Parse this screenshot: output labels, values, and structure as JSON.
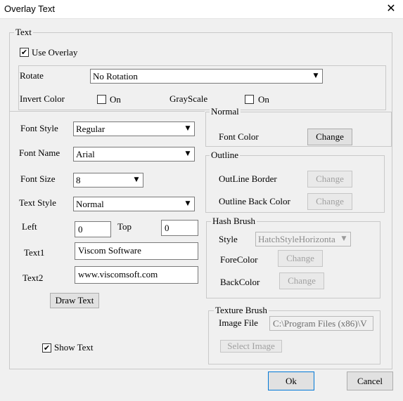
{
  "window": {
    "title": "Overlay Text",
    "close_glyph": "✕"
  },
  "text_group": {
    "legend": "Text"
  },
  "use_overlay": {
    "label": "Use Overlay",
    "checked": true
  },
  "rotate": {
    "label": "Rotate",
    "value": "No Rotation"
  },
  "invert_color": {
    "label": "Invert Color",
    "on_label": "On",
    "checked": false
  },
  "grayscale": {
    "label": "GrayScale",
    "on_label": "On",
    "checked": false
  },
  "font_style": {
    "label": "Font Style",
    "value": "Regular"
  },
  "font_name": {
    "label": "Font Name",
    "value": "Arial"
  },
  "font_size": {
    "label": "Font Size",
    "value": "8"
  },
  "text_style": {
    "label": "Text Style",
    "value": "Normal"
  },
  "left": {
    "label": "Left",
    "value": "0"
  },
  "top": {
    "label": "Top",
    "value": "0"
  },
  "text1": {
    "label": "Text1",
    "value": "Viscom Software"
  },
  "text2": {
    "label": "Text2",
    "value": "www.viscomsoft.com"
  },
  "draw_text_button": "Draw Text",
  "show_text": {
    "label": "Show Text",
    "checked": true
  },
  "normal_group": {
    "legend": "Normal",
    "font_color_label": "Font Color",
    "change_label": "Change"
  },
  "outline_group": {
    "legend": "Outline",
    "border_label": "OutLine Border",
    "back_color_label": "Outline Back Color",
    "change_label": "Change"
  },
  "hash_brush_group": {
    "legend": "Hash Brush",
    "style_label": "Style",
    "style_value": "HatchStyleHorizonta",
    "fore_color_label": "ForeColor",
    "back_color_label": "BackColor",
    "change_label": "Change"
  },
  "texture_brush_group": {
    "legend": "Texture Brush",
    "image_file_label": "Image File",
    "image_file_value": "C:\\Program Files (x86)\\V",
    "select_image_label": "Select Image"
  },
  "footer": {
    "ok_label": "Ok",
    "cancel_label": "Cancel"
  },
  "icons": {
    "check": "✔",
    "dropdown": "▼"
  }
}
